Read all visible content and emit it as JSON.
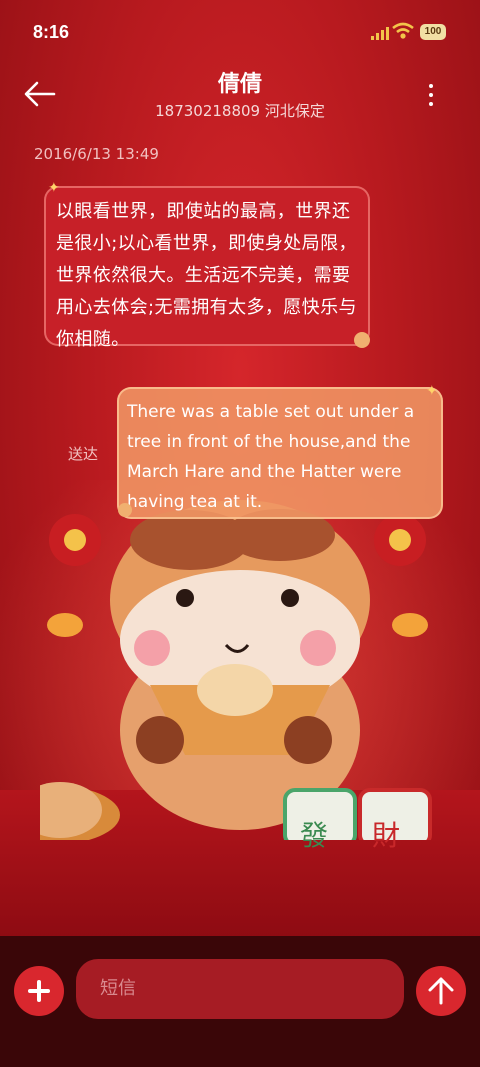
{
  "status_bar": {
    "time": "8:16",
    "battery": "100"
  },
  "header": {
    "contact_name": "倩倩",
    "contact_detail": "18730218809 河北保定"
  },
  "thread": {
    "timestamp": "2016/6/13 13:49",
    "messages": [
      {
        "direction": "incoming",
        "text": "以眼看世界，即使站的最高，世界还是很小;以心看世界，即使身处局限，世界依然很大。生活远不完美，需要用心去体会;无需拥有太多，愿快乐与你相随。"
      },
      {
        "direction": "outgoing",
        "text": "There was a table set out under a tree in front of the house,and the March Hare and the Hatter were having tea at it.",
        "status": "送达"
      }
    ]
  },
  "composer": {
    "placeholder": "短信"
  },
  "illustration": {
    "tiles": [
      "發",
      "財"
    ]
  },
  "colors": {
    "accent": "#d9272e",
    "background": "#b81a1f",
    "outgoing_bubble": "#f0966a"
  }
}
